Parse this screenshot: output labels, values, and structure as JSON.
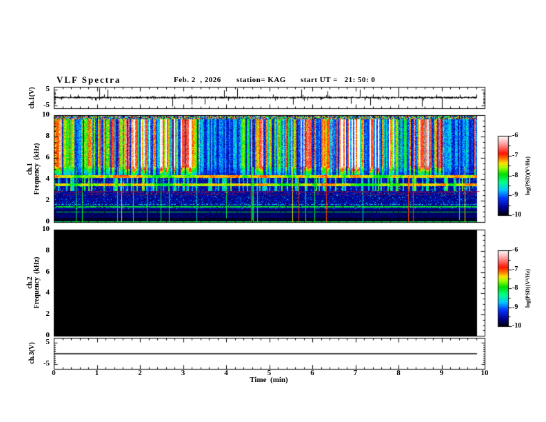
{
  "header": {
    "title": "VLF Spectra",
    "date": "Feb. 2  , 2026",
    "station": "station= KAG",
    "start_ut": "start UT =   21: 50: 0"
  },
  "x_axis": {
    "label": "Time  (min)",
    "ticks": [
      "0",
      "1",
      "2",
      "3",
      "4",
      "5",
      "6",
      "7",
      "8",
      "9",
      "10"
    ],
    "range_min": [
      0,
      10
    ],
    "minor_step_min": 0.2,
    "data_end_min": 9.83
  },
  "panels": {
    "ch1_wave": {
      "label": "ch.1(V)",
      "yticks": [
        "5",
        "-5"
      ],
      "y_range_v": [
        -5,
        5
      ]
    },
    "ch1_spec": {
      "label_channel": "ch.1",
      "label_axis": "Frequency  (kHz)",
      "yticks": [
        "10",
        "8",
        "6",
        "4",
        "2",
        "0"
      ],
      "y_range_khz": [
        0,
        10
      ]
    },
    "ch2_spec": {
      "label_channel": "ch.2",
      "label_axis": "Frequency  (kHz)",
      "yticks": [
        "10",
        "8",
        "6",
        "4",
        "2",
        "0"
      ],
      "y_range_khz": [
        0,
        10
      ]
    },
    "ch3_wave": {
      "label": "ch.3(V)",
      "yticks": [
        "5",
        "-5"
      ],
      "y_range_v": [
        -5,
        5
      ]
    }
  },
  "colorbars": [
    {
      "label": "log(PSD)(V²/Hz)",
      "ticks": [
        "-6",
        "-7",
        "-8",
        "-9",
        "-10"
      ],
      "range": [
        -6,
        -10
      ]
    },
    {
      "label": "log(PSD)(V²/Hz)",
      "ticks": [
        "-6",
        "-7",
        "-8",
        "-9",
        "-10"
      ],
      "range": [
        -6,
        -10
      ]
    }
  ],
  "colormap": {
    "stops": [
      {
        "t": 0.0,
        "c": "#000006"
      },
      {
        "t": 0.1,
        "c": "#000090"
      },
      {
        "t": 0.22,
        "c": "#0038ff"
      },
      {
        "t": 0.32,
        "c": "#00c8ff"
      },
      {
        "t": 0.42,
        "c": "#00ff88"
      },
      {
        "t": 0.52,
        "c": "#00dd00"
      },
      {
        "t": 0.6,
        "c": "#9dff00"
      },
      {
        "t": 0.66,
        "c": "#ffe000"
      },
      {
        "t": 0.72,
        "c": "#ff7000"
      },
      {
        "t": 0.78,
        "c": "#ff1400"
      },
      {
        "t": 0.9,
        "c": "#ff9c9c"
      },
      {
        "t": 1.0,
        "c": "#ffffff"
      }
    ]
  },
  "chart_data": [
    {
      "type": "line",
      "panel": "ch.1(V) waveform",
      "xlabel": "Time (min)",
      "x_range": [
        0,
        10
      ],
      "ylabel": "ch.1(V)",
      "y_range": [
        -5,
        5
      ],
      "yticks": [
        5,
        -5
      ],
      "baseline_v": 0,
      "background_noise_v": 0.3,
      "description": "broadband noise around 0 V with frequent impulsive spikes, several clipped near +/-5 V",
      "prominent_up_spike_times_min": [
        1.05,
        1.25,
        3.95,
        4.25,
        5.75,
        6.35,
        7.1,
        8.0
      ],
      "prominent_down_spike_times_min": [
        2.75,
        3.2,
        3.5,
        5.55,
        6.9,
        7.35,
        8.55,
        9.0
      ]
    },
    {
      "type": "heatmap",
      "panel": "ch.1 spectrogram",
      "xlabel": "Time (min)",
      "x_range": [
        0,
        10
      ],
      "ylabel": "Frequency (kHz)",
      "y_range": [
        0,
        10
      ],
      "z_label": "log(PSD)(V²/Hz)",
      "z_range": [
        -10,
        -6
      ],
      "bands": [
        {
          "freq_khz": [
            9.65,
            10
          ],
          "level_log_psd": "-9 to -6",
          "appearance": "dense multicolor speckle along top edge"
        },
        {
          "freq_khz": [
            5,
            9.65
          ],
          "level_log_psd": "-7 to -6",
          "appearance": "intense red/white vertical striations separated by green-cyan and dark blue gaps"
        },
        {
          "freq_khz": [
            4.2,
            5
          ],
          "level_log_psd": "-8.5 to -7",
          "appearance": "yellow-green-orange column bases over blue, yellow-green horizontal band near 4.3 kHz"
        },
        {
          "freq_khz": [
            3,
            4.2
          ],
          "level_log_psd": "-9.5 to -7.5",
          "appearance": "cyan/green vertical dashes on dark blue, yellow-green horizontal band near 3.5 kHz"
        },
        {
          "freq_khz": [
            2.55,
            3
          ],
          "level_log_psd": "-9.5",
          "appearance": "dark blue with thin maroon/red horizontal lines near 2.6, 2.8, 2.9 kHz"
        },
        {
          "freq_khz": [
            1.25,
            2.55
          ],
          "level_log_psd": "-9.8",
          "appearance": "dark blue speckle, dashed cyan line near 1.7 kHz"
        },
        {
          "freq_khz": [
            0.85,
            1.25
          ],
          "level_log_psd": "-8.2",
          "appearance": "bright green horizontal lines near 0.97 and 1.45 kHz"
        },
        {
          "freq_khz": [
            0,
            0.85
          ],
          "level_log_psd": "-10",
          "appearance": "black background crossed by sparse vertical green/cyan/red/orange impulse lines, solid green line at 0 kHz"
        }
      ],
      "impulse_vertical_lines": "about 20-25 thin full/partial-height colored lines at random times"
    },
    {
      "type": "heatmap",
      "panel": "ch.2 spectrogram",
      "xlabel": "Time (min)",
      "x_range": [
        0,
        10
      ],
      "ylabel": "Frequency (kHz)",
      "y_range": [
        0,
        10
      ],
      "z_label": "log(PSD)(V²/Hz)",
      "z_range": [
        -10,
        -6
      ],
      "bands": [
        {
          "freq_khz": [
            0,
            10
          ],
          "level_log_psd": "<= -10",
          "appearance": "uniform black, no signal"
        }
      ]
    },
    {
      "type": "line",
      "panel": "ch.3(V) waveform",
      "xlabel": "Time (min)",
      "x_range": [
        0,
        10
      ],
      "ylabel": "ch.3(V)",
      "y_range": [
        -5,
        5
      ],
      "yticks": [
        5,
        -5
      ],
      "baseline_v": 0,
      "description": "perfectly flat line at 0 V"
    }
  ]
}
